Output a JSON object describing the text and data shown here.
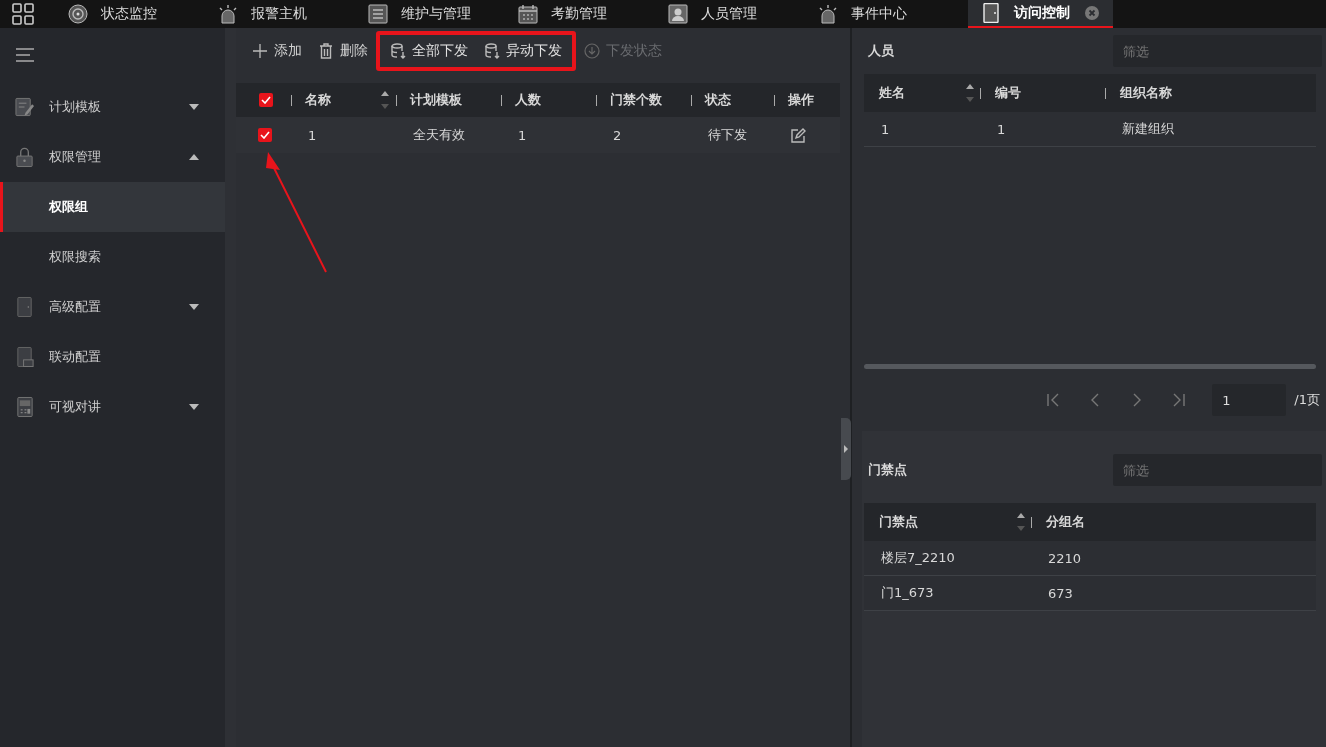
{
  "top_tabs": [
    {
      "label": "状态监控",
      "selected": false,
      "closable": false
    },
    {
      "label": "报警主机",
      "selected": false,
      "closable": false
    },
    {
      "label": "维护与管理",
      "selected": false,
      "closable": false
    },
    {
      "label": "考勤管理",
      "selected": false,
      "closable": false
    },
    {
      "label": "人员管理",
      "selected": false,
      "closable": false
    },
    {
      "label": "事件中心",
      "selected": false,
      "closable": false
    },
    {
      "label": "访问控制",
      "selected": true,
      "closable": true
    }
  ],
  "sidebar": {
    "items": [
      {
        "label": "计划模板",
        "kind": "group",
        "expanded": false,
        "selected": false
      },
      {
        "label": "权限管理",
        "kind": "group",
        "expanded": true,
        "selected": false,
        "children": [
          {
            "label": "权限组",
            "selected": true
          },
          {
            "label": "权限搜索",
            "selected": false
          }
        ]
      },
      {
        "label": "高级配置",
        "kind": "group",
        "expanded": false,
        "selected": false
      },
      {
        "label": "联动配置",
        "kind": "link",
        "selected": false
      },
      {
        "label": "可视对讲",
        "kind": "group",
        "expanded": false,
        "selected": false
      }
    ]
  },
  "toolbar": [
    {
      "label": "添加",
      "disabled": false,
      "highlighted": false
    },
    {
      "label": "删除",
      "disabled": false,
      "highlighted": false
    },
    {
      "label": "全部下发",
      "disabled": false,
      "highlighted": true
    },
    {
      "label": "异动下发",
      "disabled": false,
      "highlighted": true
    },
    {
      "label": "下发状态",
      "disabled": true,
      "highlighted": false
    }
  ],
  "table": {
    "all_checked": true,
    "columns": [
      {
        "label": "名称",
        "sortable": true
      },
      {
        "label": "计划模板",
        "sortable": false
      },
      {
        "label": "人数",
        "sortable": false
      },
      {
        "label": "门禁个数",
        "sortable": false
      },
      {
        "label": "状态",
        "sortable": false
      },
      {
        "label": "操作",
        "sortable": false
      }
    ],
    "rows": [
      {
        "checked": true,
        "cells": [
          "1",
          "全天有效",
          "1",
          "2",
          "待下发"
        ]
      }
    ]
  },
  "persons": {
    "title": "人员",
    "filter": {
      "placeholder": "筛选"
    },
    "columns": [
      {
        "label": "姓名",
        "sortable": true
      },
      {
        "label": "编号",
        "sortable": false
      },
      {
        "label": "组织名称",
        "sortable": false
      }
    ],
    "rows": [
      [
        "1",
        "1",
        "新建组织"
      ]
    ],
    "pagination": {
      "page": "1",
      "total": "/1页"
    }
  },
  "doors": {
    "title": "门禁点",
    "filter": {
      "placeholder": "筛选"
    },
    "columns": [
      {
        "label": "门禁点",
        "sortable": true
      },
      {
        "label": "分组名",
        "sortable": false
      }
    ],
    "rows": [
      [
        "楼层7_2210",
        "2210"
      ],
      [
        "门1_673",
        "673"
      ]
    ]
  }
}
